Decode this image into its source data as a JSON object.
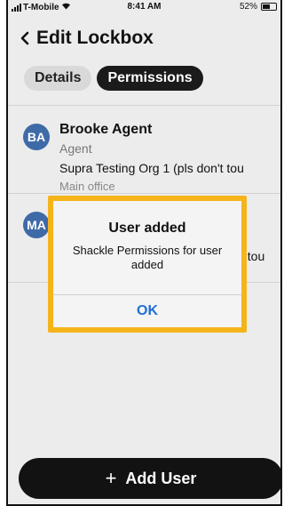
{
  "status_bar": {
    "carrier": "T-Mobile",
    "time": "8:41 AM",
    "battery": "52%"
  },
  "header": {
    "back_icon": "<",
    "title": "Edit Lockbox"
  },
  "tabs": [
    {
      "label": "Details",
      "active": false
    },
    {
      "label": "Permissions",
      "active": true
    }
  ],
  "users": [
    {
      "initials": "BA",
      "name": "Brooke Agent",
      "role": "Agent",
      "org": "Supra Testing Org 1 (pls don't tou",
      "office": "Main office"
    },
    {
      "initials": "MA",
      "name": "",
      "role": "",
      "org": "t tou",
      "office": ""
    }
  ],
  "dialog": {
    "title": "User added",
    "message": "Shackle Permissions for user added",
    "ok_label": "OK",
    "highlight_color": "#f5b51a"
  },
  "footer": {
    "add_user_label": "Add User",
    "plus_icon": "+"
  }
}
